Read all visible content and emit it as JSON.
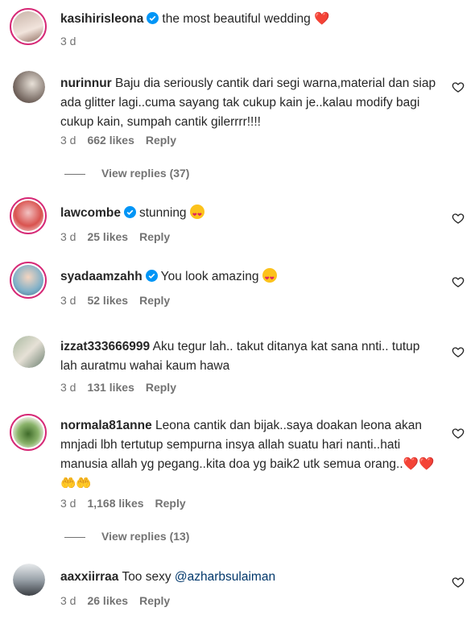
{
  "comments": [
    {
      "user": "kasihirisleona",
      "verified": true,
      "text": "the most beautiful wedding ",
      "emoji": "❤️",
      "time": "3 d",
      "likes": "",
      "reply": ""
    },
    {
      "user": "nurinnur",
      "verified": false,
      "text": "Baju dia seriously cantik dari segi warna,material dan siap ada glitter lagi..cuma sayang tak cukup kain je..kalau modify bagi cukup kain, sumpah cantik gilerrrr!!!!",
      "time": "3 d",
      "likes": "662 likes",
      "reply": "Reply",
      "view_replies": "View replies (37)"
    },
    {
      "user": "lawcombe",
      "verified": true,
      "text": "stunning ",
      "time": "3 d",
      "likes": "25 likes",
      "reply": "Reply"
    },
    {
      "user": "syadaamzahh",
      "verified": true,
      "text": "You look amazing ",
      "time": "3 d",
      "likes": "52 likes",
      "reply": "Reply"
    },
    {
      "user": "izzat333666999",
      "verified": false,
      "text": "Aku tegur lah.. takut ditanya kat sana nnti.. tutup lah auratmu wahai kaum hawa",
      "time": "3 d",
      "likes": "131 likes",
      "reply": "Reply"
    },
    {
      "user": "normala81anne",
      "verified": false,
      "text": "Leona cantik dan bijak..saya doakan leona akan mnjadi lbh tertutup sempurna insya allah suatu hari nanti..hati manusia allah yg pegang..kita doa yg baik2 utk semua orang..",
      "emoji": "❤️❤️🤲🤲",
      "time": "3 d",
      "likes": "1,168 likes",
      "reply": "Reply",
      "view_replies": "View replies (13)"
    },
    {
      "user": "aaxxiirraa",
      "verified": false,
      "text": "Too sexy ",
      "mention": "@azharbsulaiman",
      "time": "3 d",
      "likes": "26 likes",
      "reply": "Reply"
    }
  ],
  "colors": {
    "story_ring": "#d62976",
    "verified": "#0095f6",
    "meta": "#737373",
    "mention": "#00376b"
  }
}
